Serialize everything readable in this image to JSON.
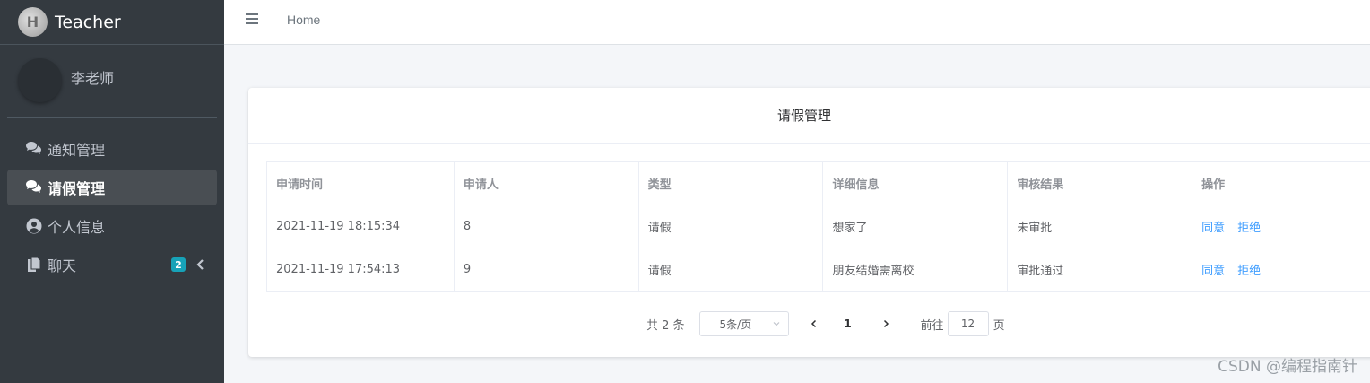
{
  "sidebar": {
    "brand": "Teacher",
    "user_name": "李老师",
    "items": [
      {
        "label": "通知管理",
        "icon": "comments-icon"
      },
      {
        "label": "请假管理",
        "icon": "comments-icon",
        "active": true
      },
      {
        "label": "个人信息",
        "icon": "user-circle-icon"
      },
      {
        "label": "聊天",
        "icon": "copy-icon",
        "badge": "2"
      }
    ]
  },
  "header": {
    "breadcrumb": "Home"
  },
  "main": {
    "card_title": "请假管理",
    "table": {
      "columns": [
        "申请时间",
        "申请人",
        "类型",
        "详细信息",
        "审核结果",
        "操作"
      ],
      "rows": [
        {
          "time": "2021-11-19 18:15:34",
          "applicant": "8",
          "type": "请假",
          "detail": "想家了",
          "result": "未审批",
          "approve": "同意",
          "reject": "拒绝"
        },
        {
          "time": "2021-11-19 17:54:13",
          "applicant": "9",
          "type": "请假",
          "detail": "朋友结婚需离校",
          "result": "审批通过",
          "approve": "同意",
          "reject": "拒绝"
        }
      ]
    },
    "pagination": {
      "total": "共 2 条",
      "page_size": "5条/页",
      "current_page": "1",
      "goto_label": "前往",
      "goto_value": "12",
      "page_suffix": "页"
    }
  },
  "watermark": "CSDN @编程指南针",
  "colors": {
    "sidebar_bg": "#343a40",
    "link": "#409eff",
    "badge": "#17a2b8"
  }
}
